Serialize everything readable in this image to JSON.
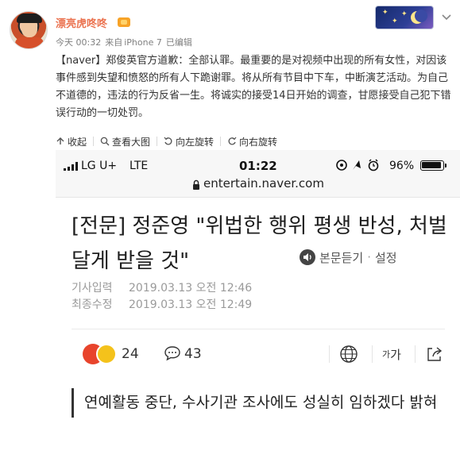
{
  "post": {
    "username": "漂亮虎咚咚",
    "time": "今天 00:32",
    "source_prefix": "来自",
    "source": "iPhone 7",
    "edited": "已编辑",
    "text": "【naver】郑俊英官方道歉：全部认罪。最重要的是对视频中出现的所有女性，对因该事件感到失望和愤怒的所有人下跪谢罪。将从所有节目中下车，中断演艺活动。为自己不道德的，违法的行为反省一生。将诚实的接受14日开始的调查，甘愿接受自己犯下错误行动的一切处罚。"
  },
  "actions": {
    "collapse": "收起",
    "view_large": "查看大图",
    "rotate_left": "向左旋转",
    "rotate_right": "向右旋转"
  },
  "screenshot": {
    "status": {
      "carrier": "LG U+",
      "network": "LTE",
      "time": "01:22",
      "battery": "96%"
    },
    "url": "entertain.naver.com",
    "headline": "[전문] 정준영 \"위법한 행위 평생 반성, 처벌 달게 받을 것\"",
    "listen_label": "본문듣기",
    "settings_label": "설정",
    "published_label": "기사입력",
    "published": "2019.03.13 오전 12:46",
    "modified_label": "최종수정",
    "modified": "2019.03.13 오전 12:49",
    "reaction_count": "24",
    "comment_count": "43",
    "font_size_small": "가",
    "font_size_large": "가",
    "quote": "연예활동 중단, 수사기관 조사에도 성실히 임하겠다 밝혀"
  },
  "colors": {
    "username": "#eb7350",
    "text": "#333333",
    "meta": "#808080",
    "image_bg": "#f2f2f2"
  },
  "icons": [
    "avatar",
    "vip-badge-icon",
    "card-badge",
    "chevron-down-icon",
    "collapse-icon",
    "zoom-icon",
    "rotate-left-icon",
    "rotate-right-icon",
    "signal-icon",
    "lock-icon",
    "speaker-icon",
    "angry-emoji",
    "laugh-emoji",
    "comment-icon",
    "globe-icon",
    "share-icon"
  ]
}
